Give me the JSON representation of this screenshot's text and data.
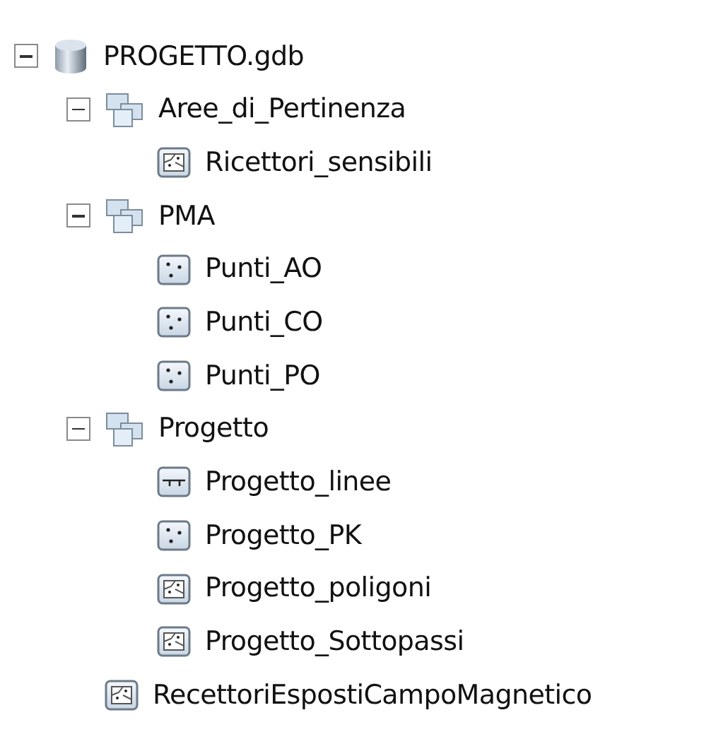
{
  "tree": [
    {
      "label": "PROGETTO.gdb",
      "kind": "database",
      "expanded": true,
      "children": [
        {
          "label": "Aree_di_Pertinenza",
          "kind": "dataset",
          "expanded": true,
          "children": [
            {
              "label": "Ricettori_sensibili",
              "kind": "polygon"
            }
          ]
        },
        {
          "label": "PMA",
          "kind": "dataset",
          "expanded": true,
          "children": [
            {
              "label": "Punti_AO",
              "kind": "point"
            },
            {
              "label": "Punti_CO",
              "kind": "point"
            },
            {
              "label": "Punti_PO",
              "kind": "point"
            }
          ]
        },
        {
          "label": "Progetto",
          "kind": "dataset",
          "expanded": true,
          "children": [
            {
              "label": "Progetto_linee",
              "kind": "line"
            },
            {
              "label": "Progetto_PK",
              "kind": "point"
            },
            {
              "label": "Progetto_poligoni",
              "kind": "polygon"
            },
            {
              "label": "Progetto_Sottopassi",
              "kind": "polygon"
            }
          ]
        },
        {
          "label": "RecettoriEspostiCampoMagnetico",
          "kind": "polygon"
        }
      ]
    }
  ]
}
